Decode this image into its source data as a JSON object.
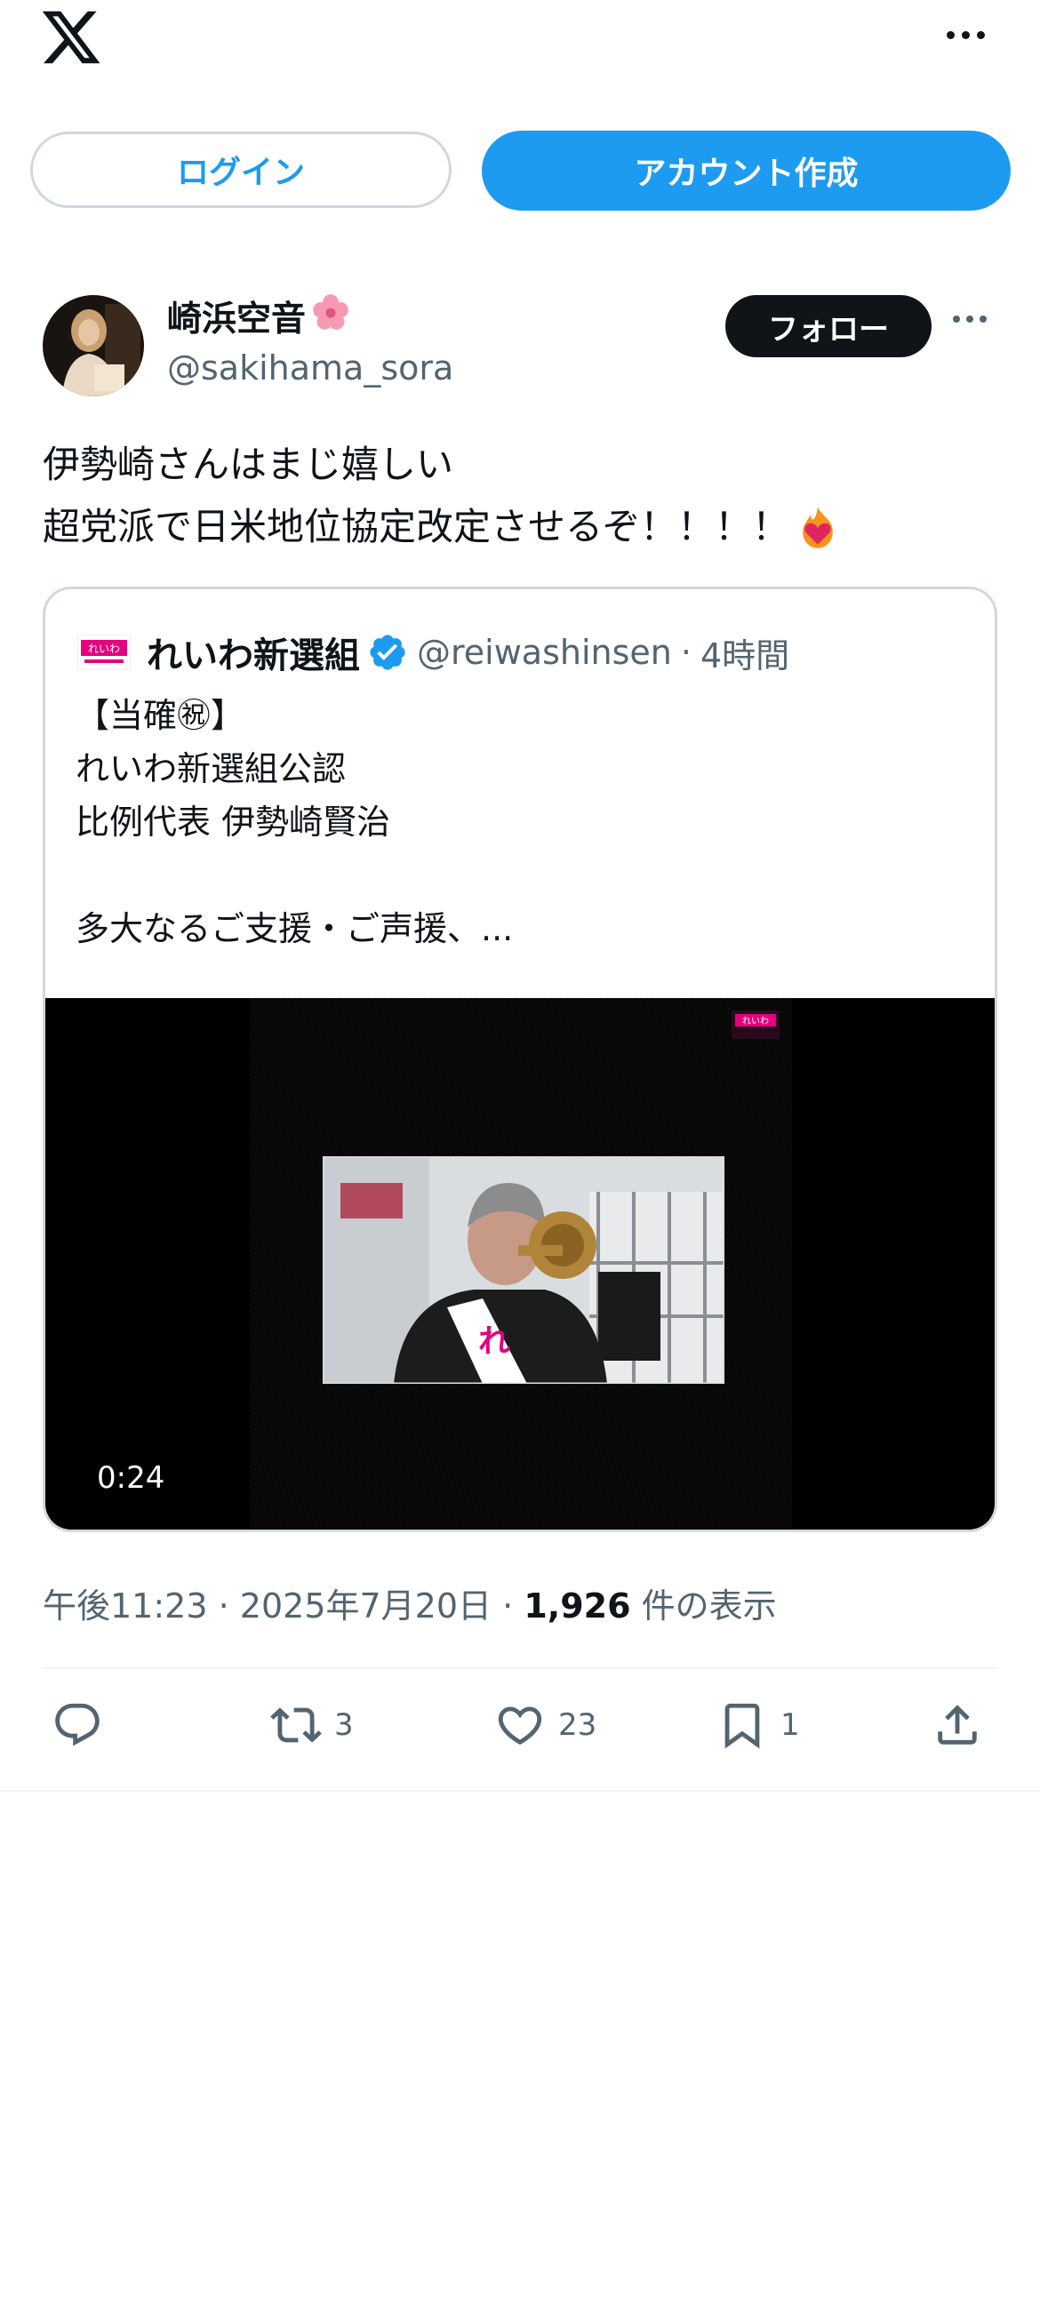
{
  "top_bar": {
    "login_label": "ログイン",
    "signup_label": "アカウント作成"
  },
  "author": {
    "name": "崎浜空音",
    "handle": "@sakihama_sora",
    "follow_label": "フォロー"
  },
  "tweet": {
    "lines": [
      "伊勢崎さんはまじ嬉しい",
      "超党派で日米地位協定改定させるぞ！！！！"
    ]
  },
  "quote": {
    "name": "れいわ新選組",
    "handle": "@reiwashinsen",
    "separator": "·",
    "time": "4時間",
    "body_lines": [
      "【当確㊗】",
      "れいわ新選組公認",
      "比例代表 伊勢崎賢治",
      "",
      "多大なるご支援・ご声援、..."
    ],
    "video_duration": "0:24"
  },
  "meta": {
    "time": "午後11:23",
    "sep1": "·",
    "date": "2025年7月20日",
    "sep2": "·",
    "views": "1,926",
    "views_label": "件の表示"
  },
  "actions": {
    "retweets": "3",
    "likes": "23",
    "bookmarks": "1"
  },
  "colors": {
    "accent": "#1d9bf0",
    "text": "#0f1419",
    "secondary": "#536471",
    "border": "#cfd9de"
  },
  "icons": [
    "x-logo-icon",
    "more-icon",
    "flower-emoji-icon",
    "fire-heart-emoji-icon",
    "verified-badge-icon",
    "reply-icon",
    "retweet-icon",
    "like-icon",
    "bookmark-icon",
    "share-icon"
  ]
}
